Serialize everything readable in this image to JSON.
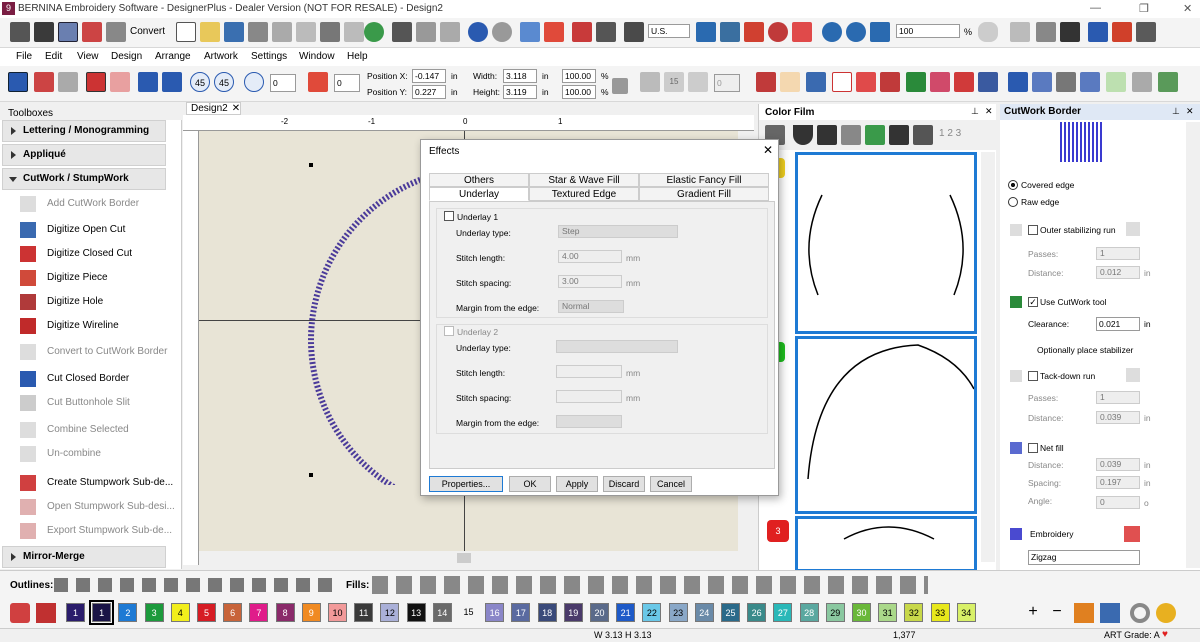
{
  "window": {
    "title": "BERNINA Embroidery Software - DesignerPlus - Dealer Version (NOT FOR RESALE) - Design2",
    "app_icon": "9"
  },
  "toolbar": {
    "convert_label": "Convert",
    "units": "U.S.",
    "zoom": "100",
    "zoom_unit": "%"
  },
  "menu": [
    "File",
    "Edit",
    "View",
    "Design",
    "Arrange",
    "Artwork",
    "Settings",
    "Window",
    "Help"
  ],
  "transform": {
    "rotate_left": "45",
    "rotate_right": "45",
    "rotate_value": "0",
    "skew_value": "0",
    "pos_x_label": "Position X:",
    "pos_x": "-0.147",
    "pos_y_label": "Position Y:",
    "pos_y": "0.227",
    "unit": "in",
    "width_label": "Width:",
    "width": "3.118",
    "height_label": "Height:",
    "height": "3.119",
    "pct_w": "100.00",
    "pct_h": "100.00",
    "pct_unit": "%",
    "rep_a": "15",
    "rep_b": "15",
    "rep_val": "0"
  },
  "toolboxes": {
    "title": "Toolboxes",
    "groups": [
      {
        "label": "Lettering / Monogramming"
      },
      {
        "label": "Appliqué"
      },
      {
        "label": "CutWork / StumpWork"
      },
      {
        "label": "Mirror-Merge"
      }
    ],
    "tools": [
      "Add CutWork Border",
      "Digitize Open Cut",
      "Digitize Closed Cut",
      "Digitize Piece",
      "Digitize Hole",
      "Digitize Wireline",
      "Convert to CutWork Border",
      "Cut Closed Border",
      "Cut Buttonhole Slit",
      "Combine Selected",
      "Un-combine",
      "Create Stumpwork Sub-de...",
      "Open Stumpwork Sub-desi...",
      "Export Stumpwork Sub-de..."
    ]
  },
  "doc_tab": "Design2",
  "ruler": {
    "labels": [
      "-2",
      "-1",
      "0",
      "1"
    ]
  },
  "color_film": {
    "title": "Color Film",
    "stack_text": "1 2 3",
    "items": [
      "1",
      "2",
      "3"
    ]
  },
  "cutwork_panel": {
    "title": "CutWork Border",
    "covered_edge": "Covered edge",
    "raw_edge": "Raw edge",
    "outer_run": "Outer stabilizing run",
    "passes_label": "Passes:",
    "distance_label": "Distance:",
    "outer_passes": "1",
    "outer_distance": "0.012",
    "unit": "in",
    "use_tool": "Use CutWork tool",
    "clearance_label": "Clearance:",
    "clearance": "0.021",
    "optional": "Optionally place stabilizer",
    "tackdown": "Tack-down run",
    "tack_passes": "1",
    "tack_distance": "0.039",
    "netfill": "Net fill",
    "net_distance": "0.039",
    "spacing_label": "Spacing:",
    "net_spacing": "0.197",
    "angle_label": "Angle:",
    "net_angle": "0",
    "angle_unit": "o",
    "embroidery": "Embroidery",
    "emb_type": "Zigzag"
  },
  "effects_dialog": {
    "title": "Effects",
    "tabs_back": [
      "Others",
      "Star & Wave Fill",
      "Elastic Fancy Fill"
    ],
    "tabs_front": [
      "Underlay",
      "Textured Edge",
      "Gradient Fill"
    ],
    "ul1": {
      "label": "Underlay 1",
      "type_label": "Underlay type:",
      "type": "Step",
      "len_label": "Stitch length:",
      "len": "4.00",
      "sp_label": "Stitch spacing:",
      "sp": "3.00",
      "margin_label": "Margin from the edge:",
      "margin": "Normal",
      "mm": "mm"
    },
    "ul2": {
      "label": "Underlay 2",
      "type_label": "Underlay type:",
      "len_label": "Stitch length:",
      "sp_label": "Stitch spacing:",
      "margin_label": "Margin from the edge:",
      "mm": "mm"
    },
    "buttons": {
      "properties": "Properties...",
      "ok": "OK",
      "apply": "Apply",
      "discard": "Discard",
      "cancel": "Cancel"
    }
  },
  "outlines_label": "Outlines:",
  "fills_label": "Fills:",
  "palette": [
    {
      "n": "1",
      "c": "#2a1c6b"
    },
    {
      "n": "1",
      "c": "#1a1446"
    },
    {
      "n": "2",
      "c": "#1e7ad4"
    },
    {
      "n": "3",
      "c": "#1c9a3c"
    },
    {
      "n": "4",
      "c": "#f2ee1c"
    },
    {
      "n": "5",
      "c": "#d61c24"
    },
    {
      "n": "6",
      "c": "#c8643a"
    },
    {
      "n": "7",
      "c": "#e01c8a"
    },
    {
      "n": "8",
      "c": "#8a2a6a"
    },
    {
      "n": "9",
      "c": "#f08a22"
    },
    {
      "n": "10",
      "c": "#f29a9a"
    },
    {
      "n": "11",
      "c": "#3a3a3a"
    },
    {
      "n": "12",
      "c": "#aab0d8"
    },
    {
      "n": "13",
      "c": "#111111"
    },
    {
      "n": "14",
      "c": "#6a6a6a"
    },
    {
      "n": "15",
      "c": "#ffffff"
    },
    {
      "n": "16",
      "c": "#8a86c8"
    },
    {
      "n": "17",
      "c": "#5a6aa0"
    },
    {
      "n": "18",
      "c": "#3a4a7a"
    },
    {
      "n": "19",
      "c": "#4a3a6a"
    },
    {
      "n": "20",
      "c": "#5a6a8a"
    },
    {
      "n": "21",
      "c": "#1e5ac8"
    },
    {
      "n": "22",
      "c": "#6ac8e8"
    },
    {
      "n": "23",
      "c": "#8aa8c8"
    },
    {
      "n": "24",
      "c": "#6a8aa8"
    },
    {
      "n": "25",
      "c": "#2a6a8a"
    },
    {
      "n": "26",
      "c": "#3a8a8a"
    },
    {
      "n": "27",
      "c": "#2ab8b8"
    },
    {
      "n": "28",
      "c": "#5aa8a0"
    },
    {
      "n": "29",
      "c": "#8ac8a0"
    },
    {
      "n": "30",
      "c": "#6ab83a"
    },
    {
      "n": "31",
      "c": "#aad88a"
    },
    {
      "n": "32",
      "c": "#c8d84a"
    },
    {
      "n": "33",
      "c": "#e8e81c"
    },
    {
      "n": "34",
      "c": "#d8f068"
    }
  ],
  "status": {
    "size": "W 3.13 H 3.13",
    "stitches": "1,377",
    "grade": "ART Grade: A"
  }
}
